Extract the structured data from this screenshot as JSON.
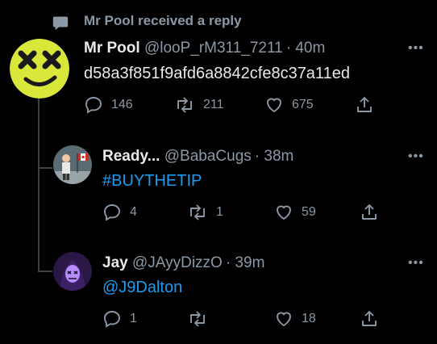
{
  "context": {
    "text": "Mr Pool received a reply"
  },
  "tweets": [
    {
      "name": "Mr Pool",
      "handle": "@looP_rM311_7211",
      "time": "· 40m",
      "text": "d58a3f851f9afd6a8842cfe8c37a11ed",
      "more": "•••",
      "replies": "146",
      "retweets": "211",
      "likes": "675",
      "avatar": "yellow-x-face-avatar"
    },
    {
      "name": "Ready...",
      "handle": "@BabaCugs",
      "time": "· 38m",
      "text": "#BUYTHETIP",
      "more": "•••",
      "replies": "4",
      "retweets": "1",
      "likes": "59",
      "avatar": "flag-person-avatar"
    },
    {
      "name": "Jay",
      "handle": "@JAyyDizzO",
      "time": "· 39m",
      "text": "@J9Dalton",
      "more": "•••",
      "replies": "1",
      "retweets": "",
      "likes": "18",
      "avatar": "purple-mask-avatar"
    }
  ],
  "colors": {
    "background": "#000000",
    "text": "#e7e9ea",
    "muted": "#8b98a5",
    "link": "#1d9bf0",
    "thread_line": "#3e4144"
  }
}
